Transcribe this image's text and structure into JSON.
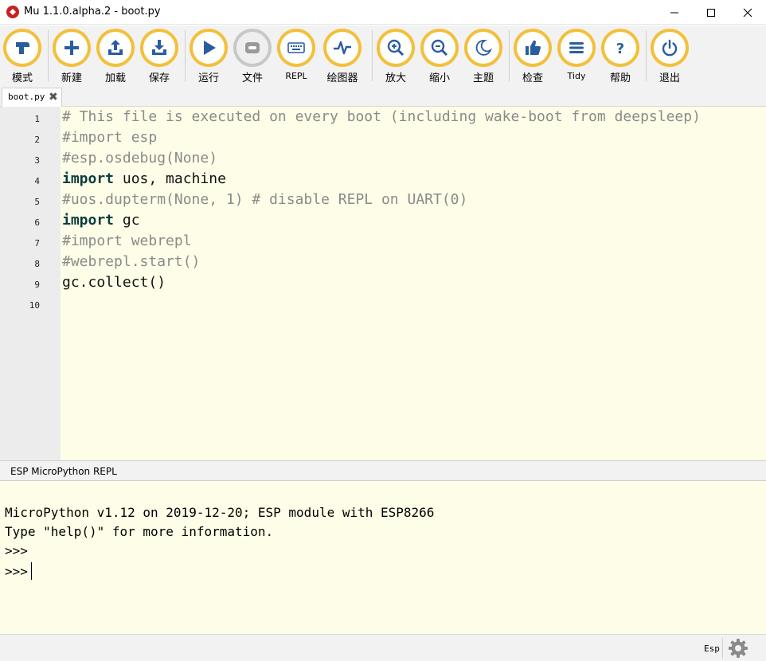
{
  "window": {
    "title": "Mu 1.1.0.alpha.2 - boot.py",
    "app_icon": "mu-logo-icon",
    "controls": [
      "minimize-icon",
      "maximize-icon",
      "close-icon"
    ]
  },
  "toolbar": {
    "accent_color": "#f3c03b",
    "buttons": [
      {
        "label": "模式",
        "icon": "mode-icon"
      },
      {
        "label": "新建",
        "icon": "plus-icon"
      },
      {
        "label": "加载",
        "icon": "upload-icon"
      },
      {
        "label": "保存",
        "icon": "download-icon"
      },
      {
        "label": "运行",
        "icon": "play-icon"
      },
      {
        "label": "文件",
        "icon": "files-icon"
      },
      {
        "label": "REPL",
        "icon": "keyboard-icon"
      },
      {
        "label": "绘图器",
        "icon": "plotter-icon"
      },
      {
        "label": "放大",
        "icon": "zoom-in-icon"
      },
      {
        "label": "缩小",
        "icon": "zoom-out-icon"
      },
      {
        "label": "主题",
        "icon": "moon-icon"
      },
      {
        "label": "检查",
        "icon": "thumbs-up-icon"
      },
      {
        "label": "Tidy",
        "icon": "tidy-icon"
      },
      {
        "label": "帮助",
        "icon": "help-icon"
      },
      {
        "label": "退出",
        "icon": "power-icon"
      }
    ]
  },
  "tabs": [
    {
      "label": "boot.py",
      "close_glyph": "✖"
    }
  ],
  "editor": {
    "line_numbers": [
      "1",
      "2",
      "3",
      "4",
      "5",
      "6",
      "7",
      "8",
      "9",
      "10"
    ],
    "lines": [
      {
        "type": "comment",
        "text": "# This file is executed on every boot (including wake-boot from deepsleep)"
      },
      {
        "type": "comment",
        "text": "#import esp"
      },
      {
        "type": "comment",
        "text": "#esp.osdebug(None)"
      },
      {
        "type": "import",
        "keyword": "import",
        "rest": " uos, machine"
      },
      {
        "type": "comment",
        "text": "#uos.dupterm(None, 1) # disable REPL on UART(0)"
      },
      {
        "type": "import",
        "keyword": "import",
        "rest": " gc"
      },
      {
        "type": "comment",
        "text": "#import webrepl"
      },
      {
        "type": "comment",
        "text": "#webrepl.start()"
      },
      {
        "type": "code",
        "text": "gc.collect()"
      },
      {
        "type": "code",
        "text": ""
      }
    ]
  },
  "repl": {
    "title": "ESP MicroPython REPL",
    "lines": [
      "MicroPython v1.12 on 2019-12-20; ESP module with ESP8266",
      "Type \"help()\" for more information.",
      ">>>",
      ">>>"
    ]
  },
  "status": {
    "mode": "Esp",
    "settings_icon": "gear-icon"
  }
}
